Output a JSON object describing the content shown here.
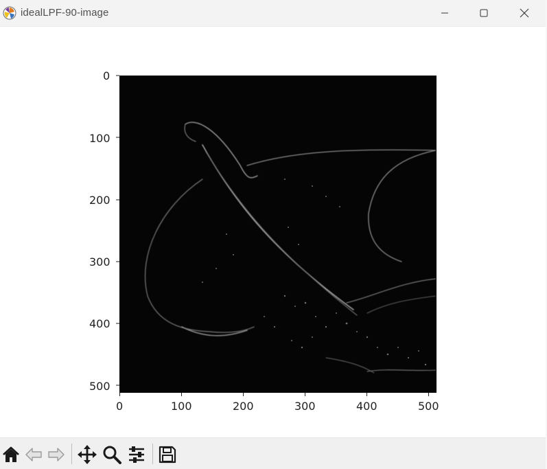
{
  "window": {
    "title": "idealLPF-90-image"
  },
  "plot": {
    "x_ticks": [
      "0",
      "100",
      "200",
      "300",
      "400",
      "500"
    ],
    "y_ticks": [
      "0",
      "100",
      "200",
      "300",
      "400",
      "500"
    ],
    "x_range": [
      0,
      512
    ],
    "y_range": [
      0,
      512
    ],
    "y_inverted": true,
    "colormap": "gray",
    "background": "#040404"
  },
  "toolbar": {
    "buttons": [
      "home-icon",
      "back-arrow-icon",
      "forward-arrow-icon",
      "pan-icon",
      "zoom-icon",
      "configure-subplots-icon",
      "save-icon"
    ]
  }
}
